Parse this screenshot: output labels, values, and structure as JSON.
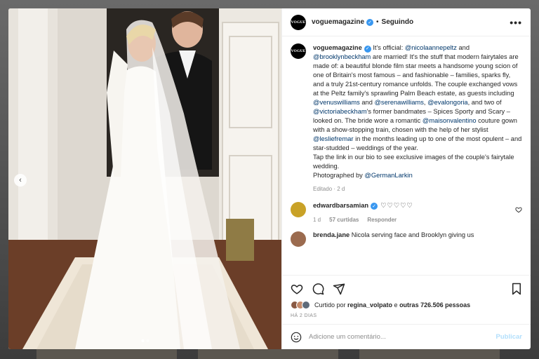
{
  "post": {
    "username": "voguemagazine",
    "avatar_text": "VOGUE",
    "separator": "•",
    "follow_label": "Seguindo",
    "more_label": "•••"
  },
  "caption": {
    "username": "voguemagazine",
    "part1": " It's official: ",
    "mention1": "@nicolaannepeltz",
    "part2": " and ",
    "mention2": "@brooklynbeckham",
    "part3": " are married! It's the stuff that modern fairytales are made of: a beautiful blonde film star meets a handsome young scion of one of Britain's most famous – and fashionable – families, sparks fly, and a truly 21st-century romance unfolds. The couple exchanged vows at the Peltz family's sprawling Palm Beach estate, as guests including ",
    "mention3": "@venuswilliams",
    "part4": " and ",
    "mention4": "@serenawilliams",
    "part5": ", ",
    "mention5": "@evalongoria",
    "part6": ", and two of ",
    "mention6": "@victoriabeckham",
    "part7": "'s former bandmates – Spices Sporty and Scary – looked on. The bride wore a romantic ",
    "mention7": "@maisonvalentino",
    "part8": " couture gown with a show-stopping train, chosen with the help of her stylist ",
    "mention8": "@lesliefremar",
    "part9": " in the months leading up to one of the most opulent – and star-studded – weddings of the year.",
    "line2": "Tap the link in our bio to see exclusive images of the couple's fairytale wedding.",
    "line3_prefix": "Photographed by ",
    "mention9": "@GermanLarkin",
    "edited": "Editado · 2 d"
  },
  "comments": [
    {
      "username": "edwardbarsamian",
      "text": "♡♡♡♡♡",
      "time": "1 d",
      "likes": "57 curtidas",
      "reply": "Responder",
      "avatar_color": "#c9a227"
    },
    {
      "username": "brenda.jane",
      "text": "Nicola serving face and Brooklyn giving us",
      "avatar_color": "#9b6b4f"
    }
  ],
  "actions": {
    "liked_prefix": "Curtido por ",
    "liked_user": "regina_volpato",
    "liked_middle": " e ",
    "liked_count": "outras 726.506 pessoas",
    "date": "HÁ 2 DIAS"
  },
  "comment_box": {
    "placeholder": "Adicione um comentário...",
    "publish": "Publicar"
  },
  "colors": {
    "verified": "#3897f0",
    "mention": "#00376b",
    "publish_disabled": "#b2dffc"
  },
  "icons": [
    "verified-icon",
    "heart-icon",
    "comment-icon",
    "share-icon",
    "bookmark-icon",
    "emoji-icon",
    "chevron-left-icon"
  ],
  "carousel": {
    "pages": 2,
    "current": 1
  }
}
